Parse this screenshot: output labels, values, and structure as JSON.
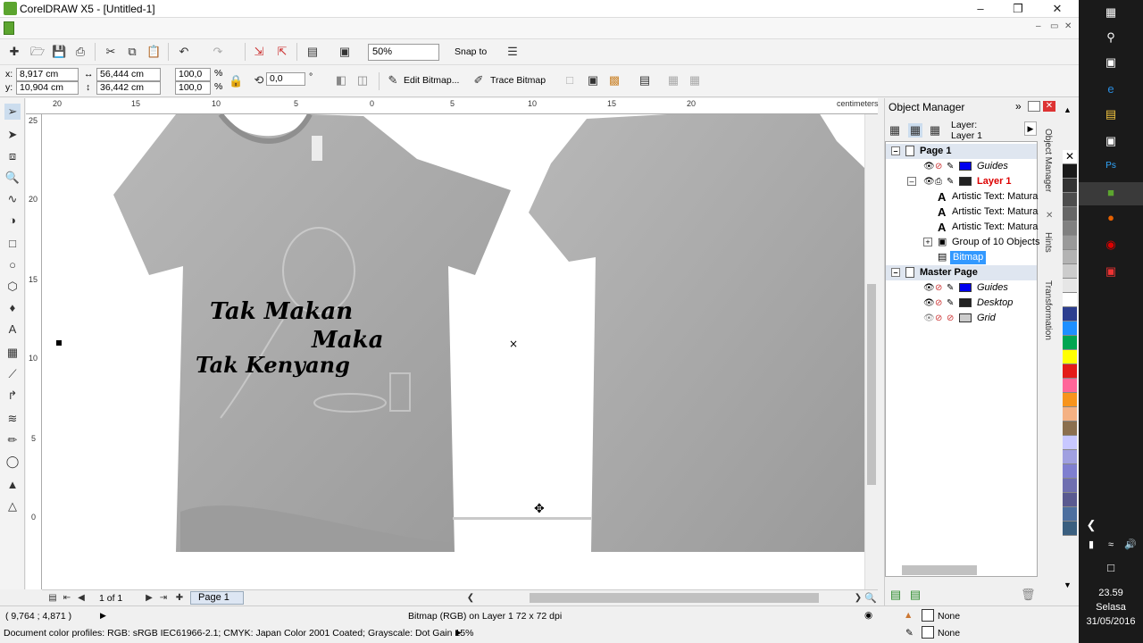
{
  "window": {
    "title": "CorelDRAW X5 - [Untitled-1]"
  },
  "toolbar": {
    "zoom": "50%",
    "snap_to": "Snap to",
    "x": "8,917 cm",
    "y": "10,904 cm",
    "width": "56,444 cm",
    "height": "36,442 cm",
    "scale_x": "100,0",
    "scale_y": "100,0",
    "percent": "%",
    "rotation": "0,0",
    "degree": "°",
    "edit_bitmap": "Edit Bitmap...",
    "trace_bitmap": "Trace Bitmap",
    "x_label": "x:",
    "y_label": "y:"
  },
  "rulers": {
    "unit": "centimeters",
    "h_ticks": [
      "20",
      "15",
      "10",
      "5",
      "0",
      "5",
      "10",
      "15",
      "20"
    ],
    "v_ticks": [
      "25",
      "20",
      "15",
      "10",
      "5",
      "0"
    ]
  },
  "artwork": {
    "line1": "Tak Makan",
    "line2": "Maka",
    "line3": "Tak Kenyang"
  },
  "page_nav": {
    "counter": "1 of 1",
    "tab": "Page 1"
  },
  "object_manager": {
    "title": "Object Manager",
    "layer_label": "Layer:",
    "layer_value": "Layer 1",
    "nodes": {
      "page1": "Page 1",
      "guides1": "Guides",
      "layer1": "Layer 1",
      "text1": "Artistic Text: Matura",
      "text2": "Artistic Text: Matura",
      "text3": "Artistic Text: Matura",
      "group": "Group of 10 Objects",
      "bitmap": "Bitmap",
      "master": "Master Page",
      "guides2": "Guides",
      "desktop": "Desktop",
      "grid": "Grid"
    },
    "colors": {
      "guides": "#0000ee",
      "layer": "#222222",
      "desktop": "#222222",
      "grid": "#cccccc"
    }
  },
  "side_tabs": {
    "object_manager": "Object Manager",
    "hints": "Hints",
    "transformation": "Transformation"
  },
  "status": {
    "coords": "( 9,764 ; 4,871 )",
    "selection": "Bitmap (RGB) on Layer 1 72 x 72 dpi",
    "profiles": "Document color profiles: RGB: sRGB IEC61966-2.1; CMYK: Japan Color 2001 Coated; Grayscale: Dot Gain 15%",
    "fill": "None",
    "outline": "None"
  },
  "taskbar": {
    "time": "23.59",
    "day": "Selasa",
    "date": "31/05/2016"
  },
  "palette_colors": [
    "#ffffff",
    "#1a1a1a",
    "#333333",
    "#4d4d4d",
    "#666666",
    "#808080",
    "#999999",
    "#b3b3b3",
    "#cccccc",
    "#e6e6e6",
    "#ffffff",
    "#2c3e8f",
    "#1e90ff",
    "#00a651",
    "#ffff00",
    "#e41b17",
    "#ff6699",
    "#f7941d",
    "#f4b183",
    "#8b6f4e",
    "#c8c8ff",
    "#a0a0e0",
    "#7f7fd0",
    "#6f6fb0",
    "#5a5a90",
    "#4d6f9f",
    "#3a5f7f"
  ]
}
